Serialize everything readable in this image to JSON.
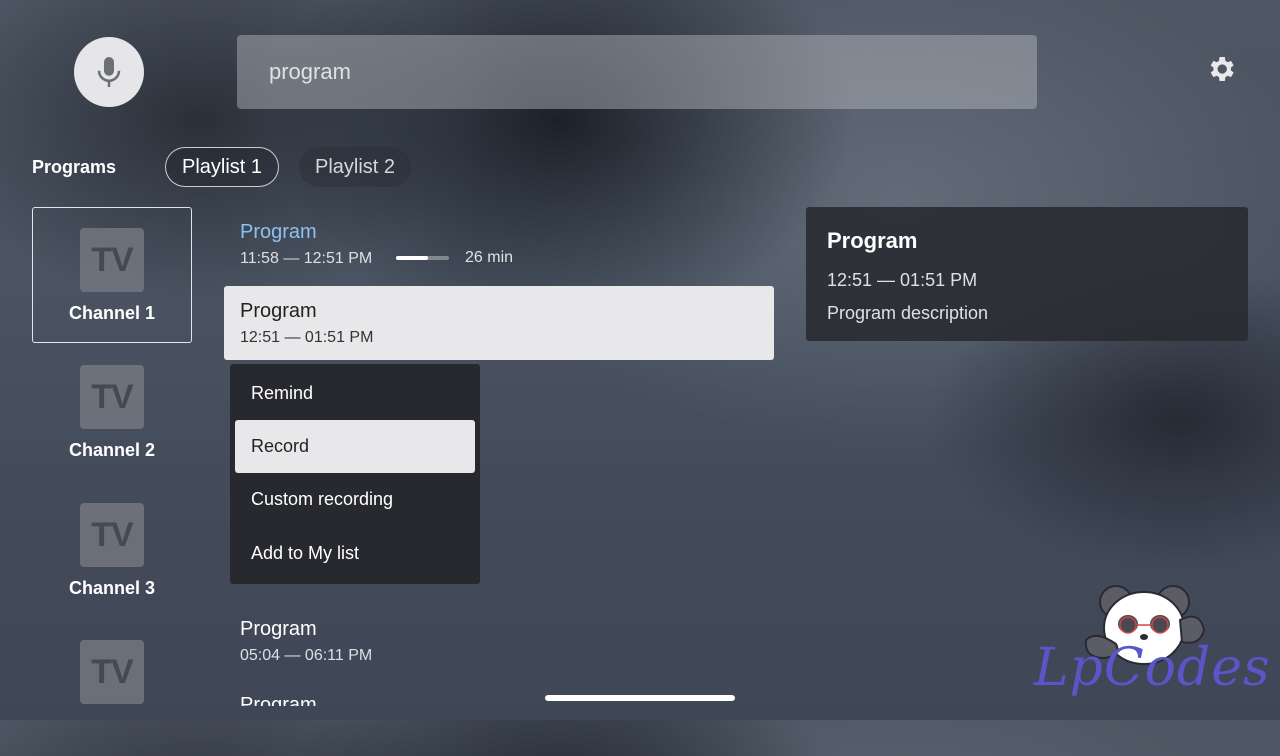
{
  "search": {
    "value": "program"
  },
  "icons": {
    "mic": "mic-icon",
    "settings": "gear-icon",
    "tv": "tv-logo-icon"
  },
  "tabs": {
    "section_label": "Programs",
    "items": [
      {
        "label": "Playlist 1",
        "selected": true
      },
      {
        "label": "Playlist 2",
        "selected": false
      }
    ]
  },
  "channels": [
    {
      "logo": "TV",
      "name": "Channel 1",
      "selected": true
    },
    {
      "logo": "TV",
      "name": "Channel 2"
    },
    {
      "logo": "TV",
      "name": "Channel 3"
    },
    {
      "logo": "TV",
      "name": ""
    }
  ],
  "programs": [
    {
      "title": "Program",
      "time": "11:58 — 12:51 PM",
      "duration": "26 min",
      "progress_pct": 60,
      "current": true
    },
    {
      "title": "Program",
      "time": "12:51 — 01:51 PM",
      "focused": true
    },
    {
      "title": "Program",
      "time": "05:04 — 06:11 PM"
    },
    {
      "title": "Program",
      "time": ""
    }
  ],
  "context_menu": {
    "items": [
      {
        "label": "Remind"
      },
      {
        "label": "Record",
        "selected": true
      },
      {
        "label": "Custom recording"
      },
      {
        "label": "Add to My list"
      }
    ]
  },
  "detail": {
    "title": "Program",
    "time": "12:51 — 01:51 PM",
    "description": "Program description"
  },
  "watermark": {
    "text": "LpCodes"
  },
  "colors": {
    "accent_link": "#8fc1f0",
    "card_bg": "#e8e8ea",
    "menu_bg": "#27292e",
    "watermark": "#5a55c8"
  }
}
